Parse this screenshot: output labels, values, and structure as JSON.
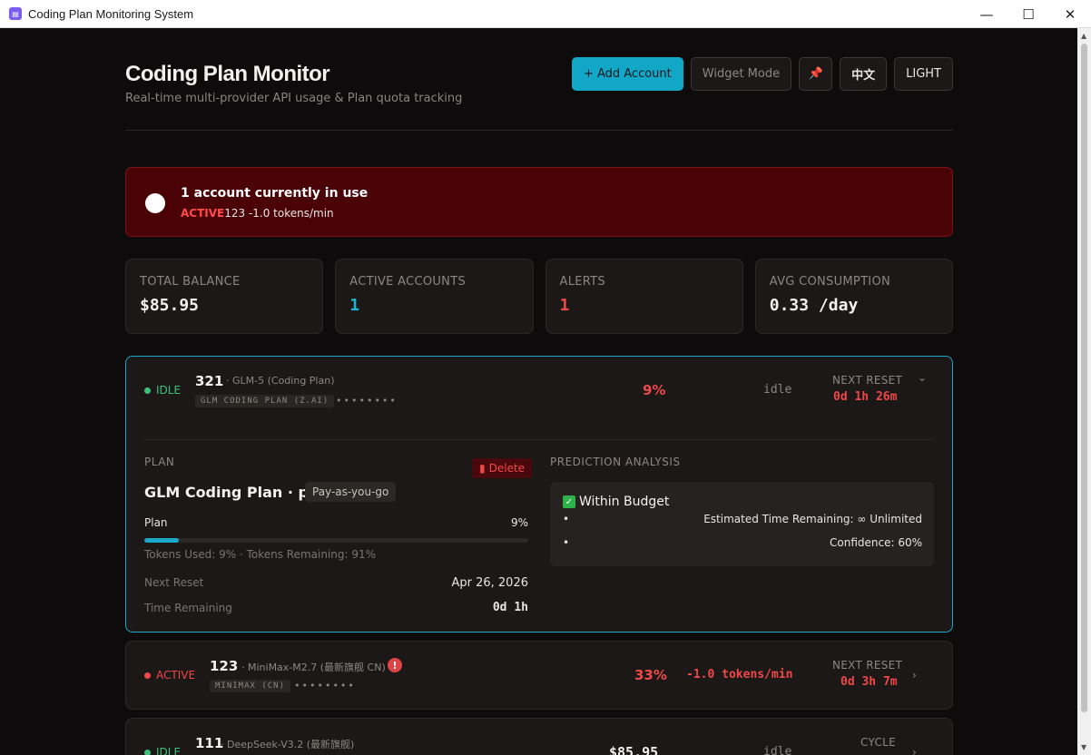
{
  "window": {
    "title": "Coding Plan Monitoring System",
    "icon": "app-icon",
    "minimize": "—",
    "maximize": "☐",
    "close": "✕"
  },
  "header": {
    "title": "Coding Plan Monitor",
    "subtitle": "Real-time multi-provider API usage & Plan quota tracking",
    "buttons": {
      "add_account": "+ Add Account",
      "widget_mode": "Widget Mode",
      "pin": "📌",
      "language": "中文",
      "theme": "LIGHT"
    }
  },
  "banner": {
    "title": "1 account currently in use",
    "status": "ACTIVE",
    "detail": "123 -1.0 tokens/min"
  },
  "stats": [
    {
      "label": "TOTAL BALANCE",
      "value": "$85.95"
    },
    {
      "label": "ACTIVE ACCOUNTS",
      "value": "1"
    },
    {
      "label": "ALERTS",
      "value": "1"
    },
    {
      "label": "AVG CONSUMPTION",
      "value": "0.33 /day"
    }
  ],
  "accounts": [
    {
      "status": "IDLE",
      "name": "321",
      "model": "· GLM-5 (Coding Plan)",
      "tag": "GLM CODING PLAN (Z.AI)",
      "key": "••••••••",
      "usage": "9%",
      "rate": "idle",
      "reset_label": "NEXT RESET",
      "reset_value": "0d 1h 26m",
      "chevron": "⌄",
      "details": {
        "plan_label": "PLAN",
        "delete": "Delete",
        "plan_name": "GLM Coding Plan · pro",
        "plan_type": "Pay-as-you-go",
        "usage_label": "Plan",
        "usage_pct": "9%",
        "usage_fraction": 0.09,
        "tokens_line": "Tokens Used: 9% · Tokens Remaining: 91%",
        "next_reset_label": "Next Reset",
        "next_reset_value": "Apr 26, 2026",
        "time_remaining_label": "Time Remaining",
        "time_remaining_value": "0d 1h",
        "prediction_label": "PREDICTION ANALYSIS",
        "prediction_status": "Within Budget",
        "estimated_time": "Estimated Time Remaining: ∞ Unlimited",
        "confidence": "Confidence: 60%"
      }
    },
    {
      "status": "ACTIVE",
      "name": "123",
      "model": "· MiniMax-M2.7 (最新旗舰 CN)",
      "tag": "MINIMAX (CN)",
      "key": "••••••••",
      "usage": "33%",
      "rate": "-1.0 tokens/min",
      "reset_label": "NEXT RESET",
      "reset_value": "0d 3h 7m",
      "chevron": "›",
      "alert": "!"
    },
    {
      "status": "IDLE",
      "name": "111",
      "model": "· DeepSeek-V3.2 (最新旗舰)",
      "usage": "$85.95",
      "rate": "idle",
      "reset_label": "CYCLE",
      "chevron": "›"
    }
  ],
  "colors": {
    "accent": "#12a7c6",
    "danger": "#ef4848",
    "idle": "#3cc27a",
    "banner_bg": "#4a0206",
    "background": "#0d0b0b"
  }
}
